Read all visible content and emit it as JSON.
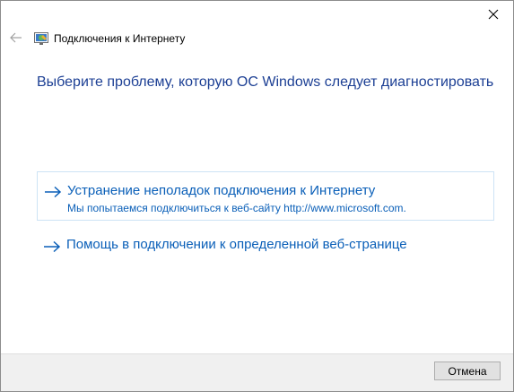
{
  "window": {
    "title": "Подключения к Интернету"
  },
  "main": {
    "heading": "Выберите проблему, которую ОС Windows следует диагностировать",
    "options": [
      {
        "title": "Устранение неполадок подключения к Интернету",
        "description": "Мы попытаемся подключиться к веб-сайту http://www.microsoft.com.",
        "selected": true
      },
      {
        "title": "Помощь в подключении к определенной веб-странице",
        "selected": false
      }
    ]
  },
  "footer": {
    "cancel_label": "Отмена"
  },
  "icons": {
    "close": "close-icon",
    "back": "back-arrow-icon",
    "app": "network-troubleshooter-icon",
    "option_arrow": "arrow-right-icon"
  },
  "colors": {
    "heading": "#1c3f94",
    "link": "#0a5fb8",
    "selection_border": "#cde3f5",
    "footer_bg": "#f0f0f0"
  }
}
